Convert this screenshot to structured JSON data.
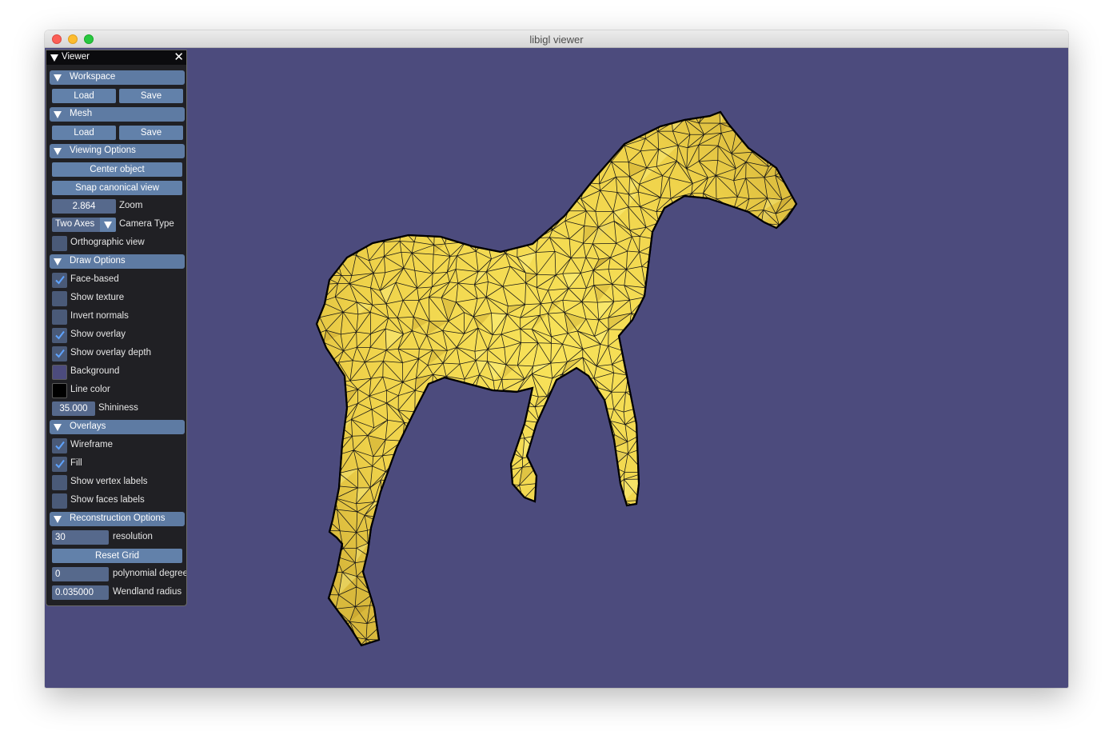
{
  "window": {
    "title": "libigl viewer"
  },
  "viewport": {
    "background_color": "#4c4b7d",
    "mesh_fill_color": "#f5e14e",
    "mesh_line_color": "#000000"
  },
  "panel": {
    "title": "Viewer",
    "close_icon": "close-icon",
    "workspace": {
      "title": "Workspace",
      "load_label": "Load",
      "save_label": "Save"
    },
    "mesh": {
      "title": "Mesh",
      "load_label": "Load",
      "save_label": "Save"
    },
    "viewing_options": {
      "title": "Viewing Options",
      "center_object_label": "Center object",
      "snap_view_label": "Snap canonical view",
      "zoom_value": "2.864",
      "zoom_label": "Zoom",
      "camera_type_value": "Two Axes",
      "camera_type_label": "Camera Type",
      "orthographic_label": "Orthographic view",
      "orthographic_checked": false
    },
    "draw_options": {
      "title": "Draw Options",
      "face_based_label": "Face-based",
      "face_based_checked": true,
      "show_texture_label": "Show texture",
      "show_texture_checked": false,
      "invert_normals_label": "Invert normals",
      "invert_normals_checked": false,
      "show_overlay_label": "Show overlay",
      "show_overlay_checked": true,
      "show_overlay_depth_label": "Show overlay depth",
      "show_overlay_depth_checked": true,
      "background_label": "Background",
      "background_color": "#4c4b7d",
      "line_color_label": "Line color",
      "line_color": "#000000",
      "shininess_value": "35.000",
      "shininess_label": "Shininess"
    },
    "overlays": {
      "title": "Overlays",
      "wireframe_label": "Wireframe",
      "wireframe_checked": true,
      "fill_label": "Fill",
      "fill_checked": true,
      "vertex_labels_label": "Show vertex labels",
      "vertex_labels_checked": false,
      "faces_labels_label": "Show faces labels",
      "faces_labels_checked": false
    },
    "reconstruction": {
      "title": "Reconstruction Options",
      "resolution_value": "30",
      "resolution_label": "resolution",
      "reset_grid_label": "Reset Grid",
      "poly_degree_value": "0",
      "poly_degree_label": "polynomial degree",
      "wendland_value": "0.035000",
      "wendland_label": "Wendland radius"
    }
  }
}
